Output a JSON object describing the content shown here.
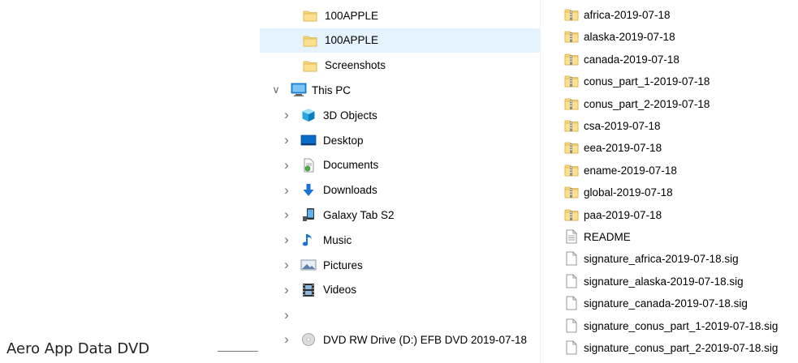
{
  "navigation": {
    "items": [
      {
        "label": "100APPLE",
        "icon": "folder-icon",
        "level": 2,
        "expander": "",
        "selected": false
      },
      {
        "label": "100APPLE",
        "icon": "folder-icon",
        "level": 2,
        "expander": "",
        "selected": true
      },
      {
        "label": "Screenshots",
        "icon": "folder-icon",
        "level": 2,
        "expander": "",
        "selected": false
      },
      {
        "label": "This PC",
        "icon": "computer-icon",
        "level": 0,
        "expander": "expanded",
        "selected": false
      },
      {
        "label": "3D Objects",
        "icon": "cube-icon",
        "level": 1,
        "expander": "collapsed",
        "selected": false
      },
      {
        "label": "Desktop",
        "icon": "desktop-icon",
        "level": 1,
        "expander": "collapsed",
        "selected": false
      },
      {
        "label": "Documents",
        "icon": "documents-icon",
        "level": 1,
        "expander": "collapsed",
        "selected": false
      },
      {
        "label": "Downloads",
        "icon": "download-arrow-icon",
        "level": 1,
        "expander": "collapsed",
        "selected": false
      },
      {
        "label": "Galaxy Tab S2",
        "icon": "tablet-icon",
        "level": 1,
        "expander": "collapsed",
        "selected": false
      },
      {
        "label": "Music",
        "icon": "music-note-icon",
        "level": 1,
        "expander": "collapsed",
        "selected": false
      },
      {
        "label": "Pictures",
        "icon": "pictures-icon",
        "level": 1,
        "expander": "collapsed",
        "selected": false
      },
      {
        "label": "Videos",
        "icon": "film-icon",
        "level": 1,
        "expander": "collapsed",
        "selected": false
      },
      {
        "label": "",
        "icon": "",
        "level": 1,
        "expander": "collapsed",
        "selected": false
      },
      {
        "label": "DVD RW Drive (D:) EFB DVD 2019-07-18",
        "icon": "dvd-drive-icon",
        "level": 1,
        "expander": "collapsed",
        "selected": false
      }
    ]
  },
  "files": {
    "items": [
      {
        "name": "africa-2019-07-18",
        "icon": "zip-folder-icon"
      },
      {
        "name": "alaska-2019-07-18",
        "icon": "zip-folder-icon"
      },
      {
        "name": "canada-2019-07-18",
        "icon": "zip-folder-icon"
      },
      {
        "name": "conus_part_1-2019-07-18",
        "icon": "zip-folder-icon"
      },
      {
        "name": "conus_part_2-2019-07-18",
        "icon": "zip-folder-icon"
      },
      {
        "name": "csa-2019-07-18",
        "icon": "zip-folder-icon"
      },
      {
        "name": "eea-2019-07-18",
        "icon": "zip-folder-icon"
      },
      {
        "name": "ename-2019-07-18",
        "icon": "zip-folder-icon"
      },
      {
        "name": "global-2019-07-18",
        "icon": "zip-folder-icon"
      },
      {
        "name": "paa-2019-07-18",
        "icon": "zip-folder-icon"
      },
      {
        "name": "README",
        "icon": "text-file-icon"
      },
      {
        "name": "signature_africa-2019-07-18.sig",
        "icon": "blank-file-icon"
      },
      {
        "name": "signature_alaska-2019-07-18.sig",
        "icon": "blank-file-icon"
      },
      {
        "name": "signature_canada-2019-07-18.sig",
        "icon": "blank-file-icon"
      },
      {
        "name": "signature_conus_part_1-2019-07-18.sig",
        "icon": "blank-file-icon"
      },
      {
        "name": "signature_conus_part_2-2019-07-18.sig",
        "icon": "blank-file-icon"
      }
    ]
  },
  "annotation": {
    "label": "Aero App Data DVD"
  },
  "colors": {
    "selection": "#e5f3ff",
    "folder": "#f8d775",
    "zip_stripe": "#d4a72c",
    "accent_blue": "#0078d7"
  }
}
